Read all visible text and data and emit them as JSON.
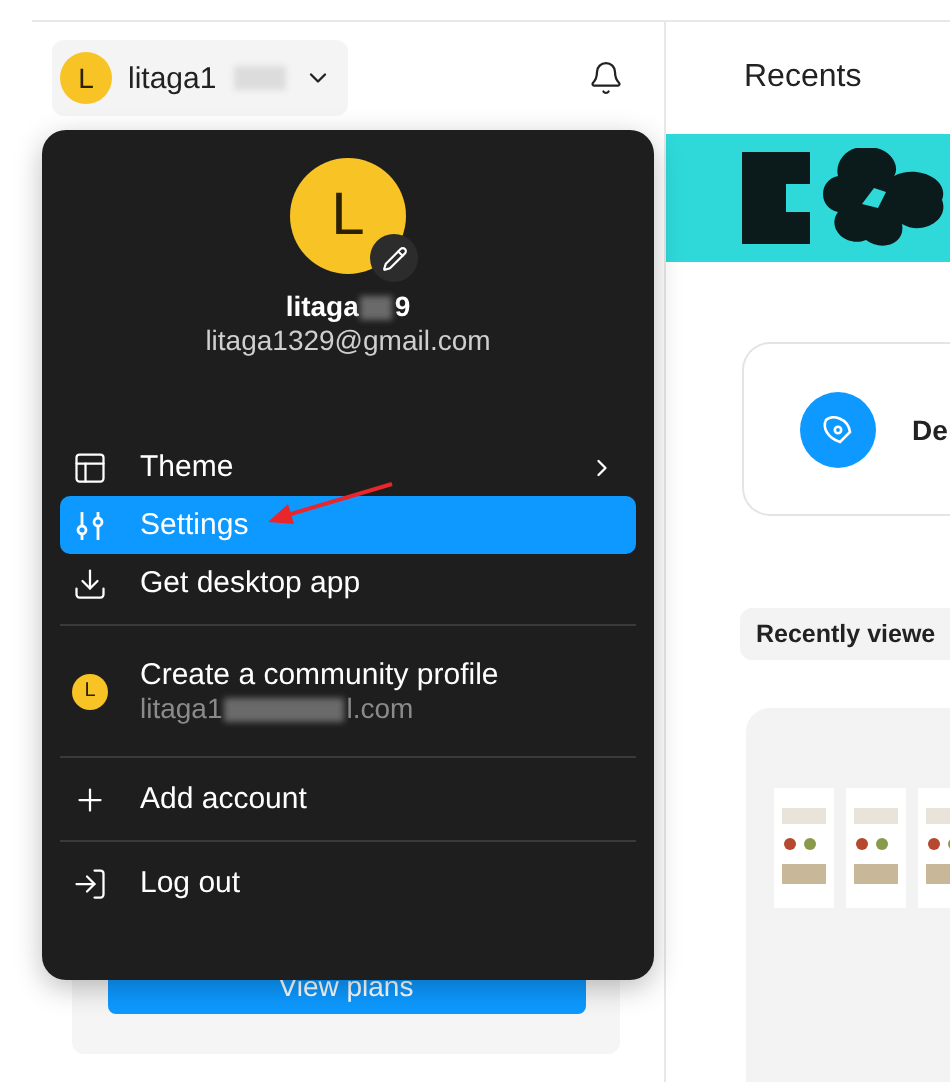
{
  "account": {
    "avatar_letter": "L",
    "name": "litaga1"
  },
  "plan_button": "View plans",
  "menu": {
    "avatar_letter": "L",
    "name_start": "litaga",
    "name_end": "9",
    "email": "litaga1329@gmail.com",
    "groups": [
      [
        {
          "kind": "option",
          "label": "Theme",
          "submenu": true,
          "selected": false
        },
        {
          "kind": "option",
          "label": "Settings",
          "submenu": false,
          "selected": true
        },
        {
          "kind": "option",
          "label": "Get desktop app",
          "submenu": false,
          "selected": false
        }
      ],
      [
        {
          "kind": "profile",
          "label": "Create a community profile",
          "avatar_letter": "L",
          "detail_start": "litaga1",
          "detail_end": "l.com",
          "selected": false
        }
      ],
      [
        {
          "kind": "option",
          "label": "Add account",
          "submenu": false,
          "selected": false
        }
      ],
      [
        {
          "kind": "option",
          "label": "Log out",
          "submenu": false,
          "selected": false
        }
      ]
    ]
  },
  "recents": {
    "title": "Recents",
    "card_label": "De",
    "section_label": "Recently viewe"
  }
}
